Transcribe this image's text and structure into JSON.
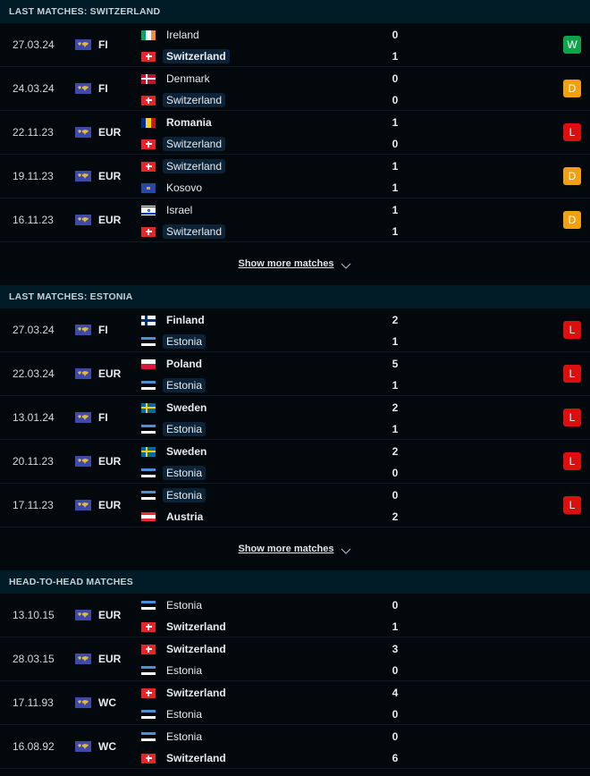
{
  "sections": [
    {
      "title": "LAST MATCHES: SWITZERLAND",
      "show_more": "Show more matches",
      "matches": [
        {
          "date": "27.03.24",
          "comp": "FI",
          "home": {
            "name": "Ireland",
            "flag": "ireland",
            "bold": false,
            "hl": false
          },
          "away": {
            "name": "Switzerland",
            "flag": "switzerland",
            "bold": true,
            "hl": true
          },
          "home_score": "0",
          "away_score": "1",
          "result": "W"
        },
        {
          "date": "24.03.24",
          "comp": "FI",
          "home": {
            "name": "Denmark",
            "flag": "denmark",
            "bold": false,
            "hl": false
          },
          "away": {
            "name": "Switzerland",
            "flag": "switzerland",
            "bold": false,
            "hl": true
          },
          "home_score": "0",
          "away_score": "0",
          "result": "D"
        },
        {
          "date": "22.11.23",
          "comp": "EUR",
          "home": {
            "name": "Romania",
            "flag": "romania",
            "bold": true,
            "hl": false
          },
          "away": {
            "name": "Switzerland",
            "flag": "switzerland",
            "bold": false,
            "hl": true
          },
          "home_score": "1",
          "away_score": "0",
          "result": "L"
        },
        {
          "date": "19.11.23",
          "comp": "EUR",
          "home": {
            "name": "Switzerland",
            "flag": "switzerland",
            "bold": false,
            "hl": true
          },
          "away": {
            "name": "Kosovo",
            "flag": "kosovo",
            "bold": false,
            "hl": false
          },
          "home_score": "1",
          "away_score": "1",
          "result": "D"
        },
        {
          "date": "16.11.23",
          "comp": "EUR",
          "home": {
            "name": "Israel",
            "flag": "israel",
            "bold": false,
            "hl": false
          },
          "away": {
            "name": "Switzerland",
            "flag": "switzerland",
            "bold": false,
            "hl": true
          },
          "home_score": "1",
          "away_score": "1",
          "result": "D"
        }
      ]
    },
    {
      "title": "LAST MATCHES: ESTONIA",
      "show_more": "Show more matches",
      "matches": [
        {
          "date": "27.03.24",
          "comp": "FI",
          "home": {
            "name": "Finland",
            "flag": "finland",
            "bold": true,
            "hl": false
          },
          "away": {
            "name": "Estonia",
            "flag": "estonia",
            "bold": false,
            "hl": true
          },
          "home_score": "2",
          "away_score": "1",
          "result": "L"
        },
        {
          "date": "22.03.24",
          "comp": "EUR",
          "home": {
            "name": "Poland",
            "flag": "poland",
            "bold": true,
            "hl": false
          },
          "away": {
            "name": "Estonia",
            "flag": "estonia",
            "bold": false,
            "hl": true
          },
          "home_score": "5",
          "away_score": "1",
          "result": "L"
        },
        {
          "date": "13.01.24",
          "comp": "FI",
          "home": {
            "name": "Sweden",
            "flag": "sweden",
            "bold": true,
            "hl": false
          },
          "away": {
            "name": "Estonia",
            "flag": "estonia",
            "bold": false,
            "hl": true
          },
          "home_score": "2",
          "away_score": "1",
          "result": "L"
        },
        {
          "date": "20.11.23",
          "comp": "EUR",
          "home": {
            "name": "Sweden",
            "flag": "sweden",
            "bold": true,
            "hl": false
          },
          "away": {
            "name": "Estonia",
            "flag": "estonia",
            "bold": false,
            "hl": true
          },
          "home_score": "2",
          "away_score": "0",
          "result": "L"
        },
        {
          "date": "17.11.23",
          "comp": "EUR",
          "home": {
            "name": "Estonia",
            "flag": "estonia",
            "bold": false,
            "hl": true
          },
          "away": {
            "name": "Austria",
            "flag": "austria",
            "bold": true,
            "hl": false
          },
          "home_score": "0",
          "away_score": "2",
          "result": "L"
        }
      ]
    },
    {
      "title": "HEAD-TO-HEAD MATCHES",
      "show_more": null,
      "matches": [
        {
          "date": "13.10.15",
          "comp": "EUR",
          "home": {
            "name": "Estonia",
            "flag": "estonia",
            "bold": false,
            "hl": false
          },
          "away": {
            "name": "Switzerland",
            "flag": "switzerland",
            "bold": true,
            "hl": false
          },
          "home_score": "0",
          "away_score": "1",
          "result": null
        },
        {
          "date": "28.03.15",
          "comp": "EUR",
          "home": {
            "name": "Switzerland",
            "flag": "switzerland",
            "bold": true,
            "hl": false
          },
          "away": {
            "name": "Estonia",
            "flag": "estonia",
            "bold": false,
            "hl": false
          },
          "home_score": "3",
          "away_score": "0",
          "result": null
        },
        {
          "date": "17.11.93",
          "comp": "WC",
          "home": {
            "name": "Switzerland",
            "flag": "switzerland",
            "bold": true,
            "hl": false
          },
          "away": {
            "name": "Estonia",
            "flag": "estonia",
            "bold": false,
            "hl": false
          },
          "home_score": "4",
          "away_score": "0",
          "result": null
        },
        {
          "date": "16.08.92",
          "comp": "WC",
          "home": {
            "name": "Estonia",
            "flag": "estonia",
            "bold": false,
            "hl": false
          },
          "away": {
            "name": "Switzerland",
            "flag": "switzerland",
            "bold": true,
            "hl": false
          },
          "home_score": "0",
          "away_score": "6",
          "result": null
        }
      ]
    }
  ],
  "colors": {
    "win": "#0fa34a",
    "draw": "#f0a010",
    "loss": "#dc0f0f",
    "header_bg": "#021c27",
    "page_bg": "#03080c",
    "highlight_bg": "#0c2236"
  }
}
